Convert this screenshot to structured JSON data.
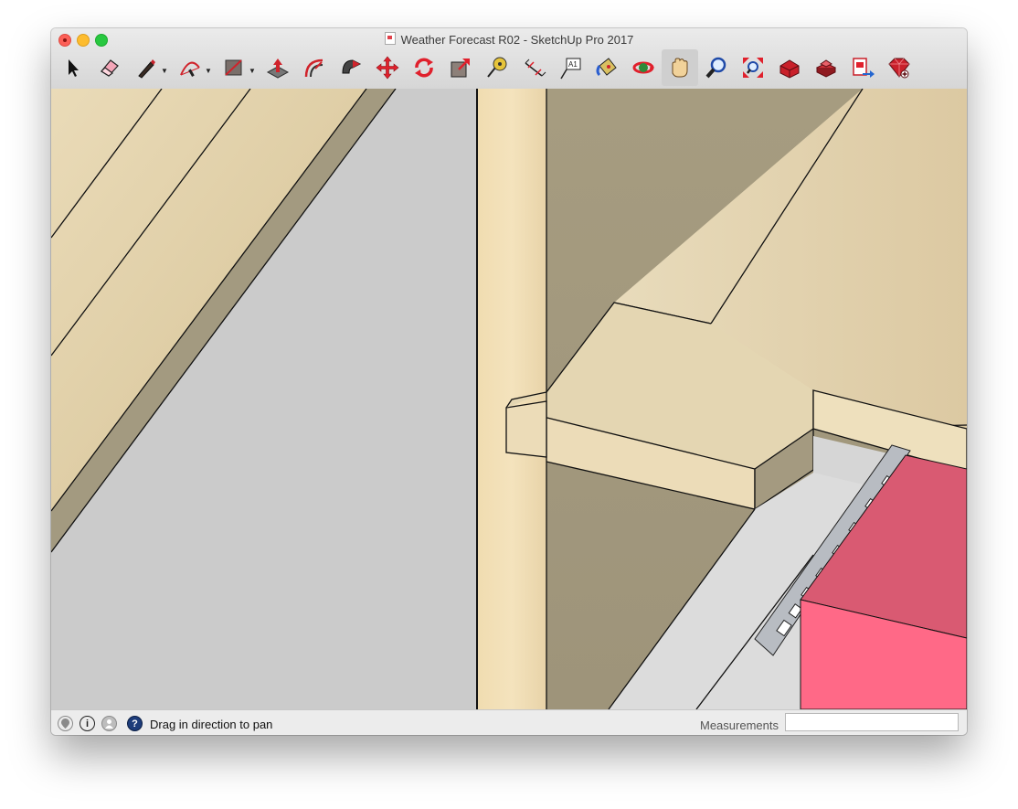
{
  "window": {
    "title": "Weather Forecast R02 - SketchUp Pro 2017"
  },
  "toolbar": {
    "tools": [
      {
        "icon": "select-arrow-icon",
        "label": "Select"
      },
      {
        "icon": "eraser-icon",
        "label": "Eraser"
      },
      {
        "icon": "line-pencil-icon",
        "label": "Line"
      },
      {
        "icon": "arc-icon",
        "label": "Arc"
      },
      {
        "icon": "rectangle-icon",
        "label": "Rectangle"
      },
      {
        "icon": "push-pull-icon",
        "label": "Push/Pull"
      },
      {
        "icon": "offset-icon",
        "label": "Offset"
      },
      {
        "icon": "follow-me-icon",
        "label": "Follow Me"
      },
      {
        "icon": "move-icon",
        "label": "Move"
      },
      {
        "icon": "rotate-icon",
        "label": "Rotate"
      },
      {
        "icon": "scale-icon",
        "label": "Scale"
      },
      {
        "icon": "tape-measure-icon",
        "label": "Tape Measure"
      },
      {
        "icon": "dimension-icon",
        "label": "Dimension"
      },
      {
        "icon": "text-label-icon",
        "label": "Text"
      },
      {
        "icon": "paint-bucket-icon",
        "label": "Paint Bucket"
      },
      {
        "icon": "orbit-icon",
        "label": "Orbit"
      },
      {
        "icon": "pan-hand-icon",
        "label": "Pan"
      },
      {
        "icon": "zoom-icon",
        "label": "Zoom"
      },
      {
        "icon": "zoom-extents-icon",
        "label": "Zoom Extents"
      },
      {
        "icon": "3d-warehouse-icon",
        "label": "3D Warehouse"
      },
      {
        "icon": "extension-warehouse-icon",
        "label": "Extension Warehouse"
      },
      {
        "icon": "send-to-layout-icon",
        "label": "Send to LayOut"
      },
      {
        "icon": "extension-manager-icon",
        "label": "Extension Manager"
      }
    ],
    "text_tool_glyph": "A1",
    "active_tool": "Pan"
  },
  "status": {
    "message": "Drag in direction to pan",
    "help_glyph": "?",
    "info_glyph": "i"
  },
  "measurements": {
    "label": "Measurements",
    "value": ""
  },
  "colors": {
    "wood_light": "#e6d6b2",
    "wood_shadow": "#a39a80",
    "floor_gray": "#cbcbcb",
    "pink_block": "#ff6987",
    "pink_top": "#d95a72",
    "accent_red": "#d0232b"
  }
}
